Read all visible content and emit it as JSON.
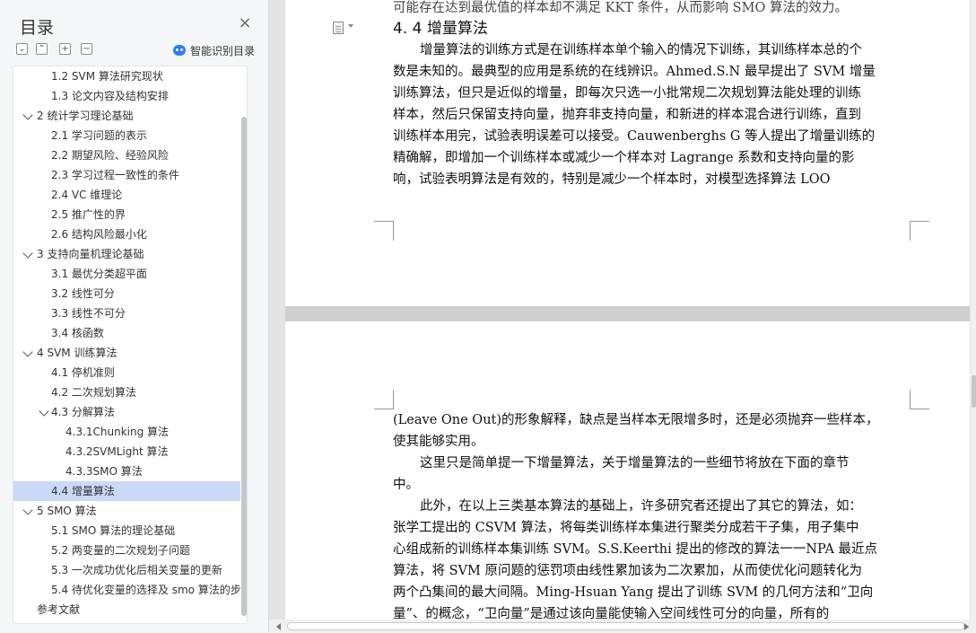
{
  "toc": {
    "title": "目录",
    "close_glyph": "×",
    "ai_label": "智能识别目录",
    "toolbar": [
      "⌄",
      "⌃",
      "+",
      "−"
    ],
    "items": [
      {
        "label": "1.2 SVM 算法研究现状",
        "level": 2
      },
      {
        "label": "1.3  论文内容及结构安排",
        "level": 2
      },
      {
        "label": "2  统计学习理论基础",
        "level": 1,
        "expanded": true
      },
      {
        "label": "2.1  学习问题的表示",
        "level": 2
      },
      {
        "label": "2.2  期望风险、经验风险",
        "level": 2
      },
      {
        "label": "2.3  学习过程一致性的条件",
        "level": 2
      },
      {
        "label": "2.4 VC 维理论",
        "level": 2
      },
      {
        "label": "2.5  推广性的界",
        "level": 2
      },
      {
        "label": "2.6  结构风险最小化",
        "level": 2
      },
      {
        "label": "3  支持向量机理论基础",
        "level": 1,
        "expanded": true
      },
      {
        "label": "3.1  最优分类超平面",
        "level": 2
      },
      {
        "label": "3.2  线性可分",
        "level": 2
      },
      {
        "label": "3.3  线性不可分",
        "level": 2
      },
      {
        "label": "3.4  核函数",
        "level": 2
      },
      {
        "label": "4 SVM 训练算法",
        "level": 1,
        "expanded": true
      },
      {
        "label": "4.1  停机准则",
        "level": 2
      },
      {
        "label": "4.2  二次规划算法",
        "level": 2
      },
      {
        "label": "4.3  分解算法",
        "level": 2,
        "expanded": true
      },
      {
        "label": "4.3.1Chunking 算法",
        "level": 3
      },
      {
        "label": "4.3.2SVMLight 算法",
        "level": 3
      },
      {
        "label": "4.3.3SMO 算法",
        "level": 3
      },
      {
        "label": "4.4  增量算法",
        "level": 2,
        "active": true
      },
      {
        "label": "5 SMO 算法",
        "level": 1,
        "expanded": true
      },
      {
        "label": "5.1 SMO 算法的理论基础",
        "level": 2
      },
      {
        "label": "5.2  两变量的二次规划子问题",
        "level": 2
      },
      {
        "label": "5.3  一次成功优化后相关变量的更新",
        "level": 2
      },
      {
        "label": "5.4  待优化变量的选择及 smo 算法的步骤",
        "level": 2
      },
      {
        "label": "参考文献",
        "level": 1
      }
    ]
  },
  "document": {
    "page1": {
      "cut_line": "可能存在达到最优值的样本却不满足 KKT 条件，从而影响 SMO 算法的效力。",
      "heading": "4. 4  增量算法",
      "lines": [
        {
          "text": "增量算法的训练方式是在训练样本单个输入的情况下训练，其训练样本总的个",
          "indent": true
        },
        {
          "text": "数是未知的。最典型的应用是系统的在线辨识。Ahmed.S.N 最早提出了 SVM 增量",
          "indent": false
        },
        {
          "text": "训练算法，但只是近似的增量，即每次只选一小批常规二次规划算法能处理的训练",
          "indent": false
        },
        {
          "text": "样本，然后只保留支持向量，抛弃非支持向量，和新进的样本混合进行训练，直到",
          "indent": false
        },
        {
          "text": "训练样本用完，试验表明误差可以接受。Cauwenberghs G 等人提出了增量训练的",
          "indent": false
        },
        {
          "text": "精确解，即增加一个训练样本或减少一个样本对 Lagrange 系数和支持向量的影",
          "indent": false
        },
        {
          "text": "响，试验表明算法是有效的，特别是减少一个样本时，对模型选择算法 LOO",
          "indent": false
        }
      ]
    },
    "page2": {
      "lines": [
        {
          "text": "(Leave One Out)的形象解释，缺点是当样本无限增多时，还是必须抛弃一些样本，",
          "indent": false
        },
        {
          "text": "使其能够实用。",
          "indent": false
        },
        {
          "text": "这里只是简单提一下增量算法，关于增量算法的一些细节将放在下面的章节",
          "indent": true
        },
        {
          "text": "中。",
          "indent": false
        },
        {
          "text": "此外，在以上三类基本算法的基础上，许多研究者还提出了其它的算法，如：",
          "indent": true
        },
        {
          "text": "张学工提出的 CSVM 算法，将每类训练样本集进行聚类分成若干子集，用子集中",
          "indent": false
        },
        {
          "text": "心组成新的训练样本集训练 SVM。S.S.Keerthi 提出的修改的算法一一NPA 最近点",
          "indent": false
        },
        {
          "text": "算法，将 SVM 原问题的惩罚项由线性累加该为二次累加，从而使优化问题转化为",
          "indent": false
        },
        {
          "text": "两个凸集间的最大间隔。Ming-Hsuan Yang 提出了训练 SVM 的几何方法和“卫向",
          "indent": false
        },
        {
          "text": "量”、的概念，“卫向量”是通过该向量能使输入空间线性可分的向量，所有的",
          "indent": false
        }
      ]
    }
  },
  "colors": {
    "active_bg": "#c9daf8",
    "accent": "#2e7cf6",
    "page_gap": "#cfcfcf"
  }
}
